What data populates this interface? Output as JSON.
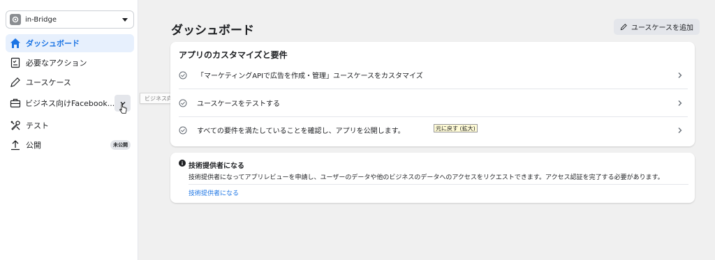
{
  "app_selector": {
    "name": "in-Bridge"
  },
  "sidebar": {
    "items": [
      {
        "label": "ダッシュボード",
        "icon": "home-icon",
        "active": true
      },
      {
        "label": "必要なアクション",
        "icon": "checklist-icon"
      },
      {
        "label": "ユースケース",
        "icon": "pencil-icon"
      },
      {
        "label": "ビジネス向けFacebook...",
        "icon": "briefcase-icon"
      },
      {
        "label": "テスト",
        "icon": "tools-icon"
      },
      {
        "label": "公開",
        "icon": "upload-icon",
        "badge": "未公開"
      }
    ]
  },
  "tooltip": {
    "text": "ビジネス向けFacebookログイン"
  },
  "main": {
    "title": "ダッシュボード",
    "add_usecase_label": "ユースケースを追加",
    "customize_card": {
      "title": "アプリのカスタマイズと要件",
      "rows": [
        {
          "label": "「マーケティングAPIで広告を作成・管理」ユースケースをカスタマイズ"
        },
        {
          "label": "ユースケースをテストする"
        },
        {
          "label": "すべての要件を満たしていることを確認し、アプリを公開します。"
        }
      ],
      "restore_tag": "元に戻す (拡大)"
    },
    "tech_provider_card": {
      "title": "技術提供者になる",
      "description": "技術提供者になってアプリレビューを申請し、ユーザーのデータや他のビジネスのデータへのアクセスをリクエストできます。アクセス認証を完了する必要があります。",
      "link": "技術提供者になる"
    }
  },
  "colors": {
    "accent": "#1b74e4",
    "active_bg": "#e7f0fd",
    "page_bg": "#f0f0f0"
  }
}
